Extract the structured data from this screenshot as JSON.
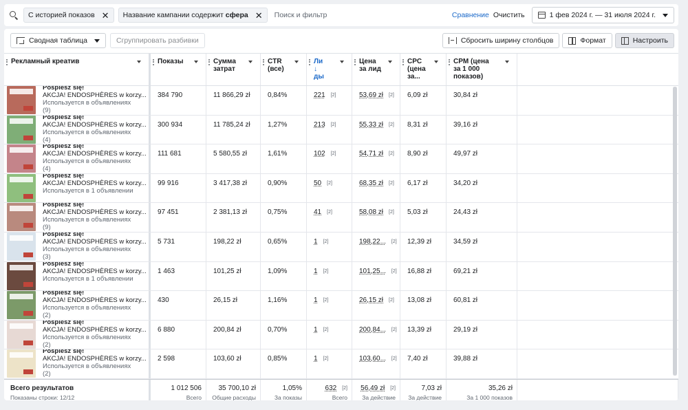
{
  "filterbar": {
    "chip1": "С историей показов",
    "chip2_prefix": "Название кампании содержит",
    "chip2_value": "сфера",
    "search_placeholder": "Поиск и фильтр",
    "compare": "Сравнение",
    "clear": "Очистить",
    "date_range": "1 фев 2024 г. — 31 июля 2024 г."
  },
  "toolbar": {
    "pivot": "Сводная таблица",
    "group": "Сгруппировать разбивки",
    "reset_width": "Сбросить ширину столбцов",
    "format": "Формат",
    "configure": "Настроить"
  },
  "columns": [
    {
      "label": "Рекламный креатив"
    },
    {
      "label": "Показы"
    },
    {
      "label": "Сумма затрат"
    },
    {
      "label": "CTR (все)"
    },
    {
      "label": "Ли ↓ ды"
    },
    {
      "label": "Цена за лид"
    },
    {
      "label": "CPC (цена за..."
    },
    {
      "label": "CPM (цена за 1 000 показов)"
    }
  ],
  "rows": [
    {
      "title": "Pośpiesz się!",
      "name": "AKCJA! ENDOSPHÈRES w korzy...",
      "usage": "Используется в объявлениях",
      "count": "(9)",
      "thumb": "#b86a5c",
      "impressions": "384 790",
      "spend": "11 866,29 zł",
      "ctr": "0,84%",
      "leads": "221",
      "cpl": "53,69 zł",
      "cpc": "6,09 zł",
      "cpm": "30,84 zł"
    },
    {
      "title": "Pośpiesz się!",
      "name": "AKCJA! ENDOSPHÈRES w korzy...",
      "usage": "Используется в объявлениях",
      "count": "(4)",
      "thumb": "#7fae77",
      "impressions": "300 934",
      "spend": "11 785,24 zł",
      "ctr": "1,27%",
      "leads": "213",
      "cpl": "55,33 zł",
      "cpc": "8,31 zł",
      "cpm": "39,16 zł"
    },
    {
      "title": "Pośpiesz się!",
      "name": "AKCJA! ENDOSPHÈRES w korzy...",
      "usage": "Используется в объявлениях",
      "count": "(4)",
      "thumb": "#c4848a",
      "impressions": "111 681",
      "spend": "5 580,55 zł",
      "ctr": "1,61%",
      "leads": "102",
      "cpl": "54,71 zł",
      "cpc": "8,90 zł",
      "cpm": "49,97 zł"
    },
    {
      "title": "Pośpiesz się!",
      "name": "AKCJA! ENDOSPHÈRES w korzy...",
      "usage": "Используется в 1 объявлении",
      "count": "",
      "thumb": "#8fbf7e",
      "impressions": "99 916",
      "spend": "3 417,38 zł",
      "ctr": "0,90%",
      "leads": "50",
      "cpl": "68,35 zł",
      "cpc": "6,17 zł",
      "cpm": "34,20 zł"
    },
    {
      "title": "Pośpiesz się!",
      "name": "AKCJA! ENDOSPHÈRES w korzy...",
      "usage": "Используется в объявлениях",
      "count": "(9)",
      "thumb": "#b98a7e",
      "impressions": "97 451",
      "spend": "2 381,13 zł",
      "ctr": "0,75%",
      "leads": "41",
      "cpl": "58,08 zł",
      "cpc": "5,03 zł",
      "cpm": "24,43 zł"
    },
    {
      "title": "Pośpiesz się!",
      "name": "AKCJA! ENDOSPHÈRES w korzy...",
      "usage": "Используется в объявлениях",
      "count": "(3)",
      "thumb": "#d9e3ec",
      "impressions": "5 731",
      "spend": "198,22 zł",
      "ctr": "0,65%",
      "leads": "1",
      "cpl": "198,22...",
      "cpc": "12,39 zł",
      "cpm": "34,59 zł"
    },
    {
      "title": "Pośpiesz się!",
      "name": "AKCJA! ENDOSPHÈRES w korzy...",
      "usage": "Используется в 1 объявлении",
      "count": "",
      "thumb": "#6b4a3f",
      "impressions": "1 463",
      "spend": "101,25 zł",
      "ctr": "1,09%",
      "leads": "1",
      "cpl": "101,25...",
      "cpc": "16,88 zł",
      "cpm": "69,21 zł"
    },
    {
      "title": "Pośpiesz się!",
      "name": "AKCJA! ENDOSPHÈRES w korzy...",
      "usage": "Используется в объявлениях",
      "count": "(2)",
      "thumb": "#7c9a69",
      "impressions": "430",
      "spend": "26,15 zł",
      "ctr": "1,16%",
      "leads": "1",
      "cpl": "26,15 zł",
      "cpc": "13,08 zł",
      "cpm": "60,81 zł"
    },
    {
      "title": "Pośpiesz się!",
      "name": "AKCJA! ENDOSPHÈRES w korzy...",
      "usage": "Используется в объявлениях",
      "count": "(2)",
      "thumb": "#e7d9d4",
      "impressions": "6 880",
      "spend": "200,84 zł",
      "ctr": "0,70%",
      "leads": "1",
      "cpl": "200,84...",
      "cpc": "13,39 zł",
      "cpm": "29,19 zł"
    },
    {
      "title": "Pośpiesz się!",
      "name": "AKCJA! ENDOSPHÈRES w korzy...",
      "usage": "Используется в объявлениях",
      "count": "(2)",
      "thumb": "#ede3c8",
      "impressions": "2 598",
      "spend": "103,60 zł",
      "ctr": "0,85%",
      "leads": "1",
      "cpl": "103,60...",
      "cpc": "7,40 zł",
      "cpm": "39,88 zł"
    }
  ],
  "ref_marker": "[2]",
  "footer": {
    "title": "Всего результатов",
    "rows_shown": "Показаны строки: 12/12",
    "impressions": "1 012 506",
    "impressions_sub": "Всего",
    "spend": "35 700,10 zł",
    "spend_sub": "Общие расходы",
    "ctr": "1,05%",
    "ctr_sub": "За показы",
    "leads": "632",
    "leads_sub": "Всего",
    "cpl": "56,49 zł",
    "cpl_sub": "За действие",
    "cpc": "7,03 zł",
    "cpc_sub": "За действие",
    "cpm": "35,26 zł",
    "cpm_sub": "За 1 000 показов"
  }
}
